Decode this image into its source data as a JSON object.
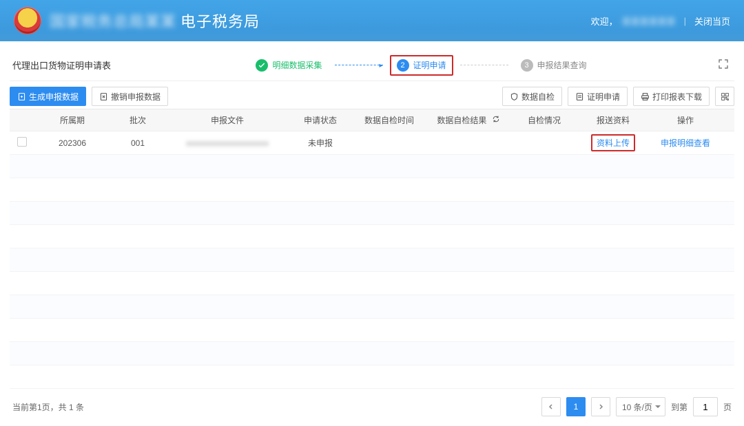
{
  "header": {
    "title_suffix": "电子税务局",
    "welcome": "欢迎，",
    "close": "关闭当页"
  },
  "page": {
    "name": "代理出口货物证明申请表"
  },
  "steps": {
    "s1": {
      "label": "明细数据采集"
    },
    "s2": {
      "num": "2",
      "label": "证明申请"
    },
    "s3": {
      "num": "3",
      "label": "申报结果查询"
    }
  },
  "toolbar": {
    "gen": "生成申报数据",
    "revoke": "撤销申报数据",
    "self_check": "数据自检",
    "cert_apply": "证明申请",
    "print": "打印报表下载"
  },
  "columns": {
    "period": "所属期",
    "batch": "批次",
    "file": "申报文件",
    "status": "申请状态",
    "chktime": "数据自检时间",
    "chkres": "数据自检结果",
    "chkinfo": "自检情况",
    "mat": "报送资料",
    "op": "操作"
  },
  "rows": [
    {
      "period": "202306",
      "batch": "001",
      "file": "",
      "status": "未申报",
      "chktime": "",
      "chkres": "",
      "chkinfo": "",
      "mat": "资料上传",
      "op": "申报明细查看"
    }
  ],
  "pager": {
    "info": "当前第1页，共 1 条",
    "current": "1",
    "size": "10 条/页",
    "jump_label_pre": "到第",
    "jump_value": "1",
    "jump_label_post": "页"
  }
}
